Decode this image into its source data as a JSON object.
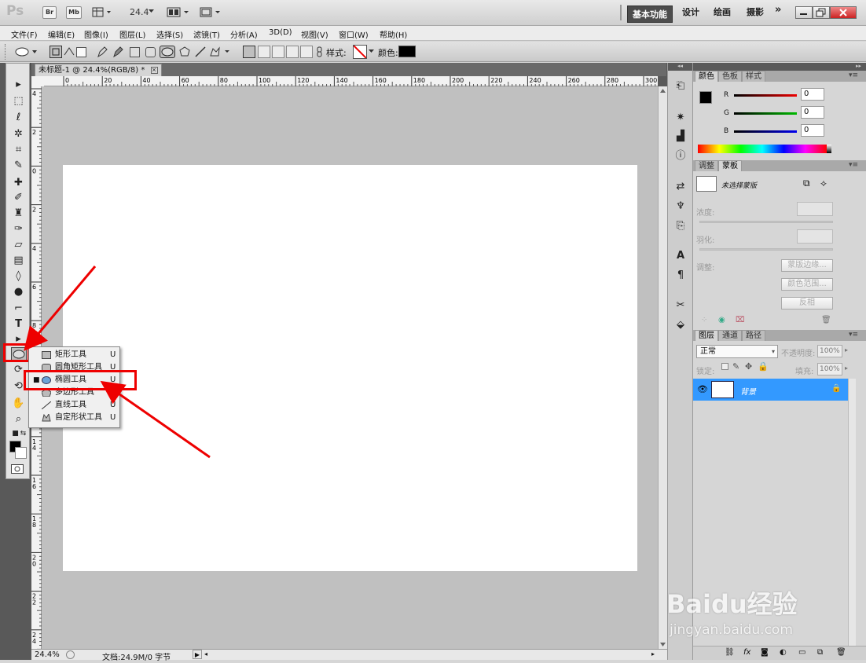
{
  "appbar": {
    "logo": "Ps",
    "bridge": "Br",
    "minibridge": "Mb",
    "zoom": "24.4",
    "workspaces": [
      "基本功能",
      "设计",
      "绘画",
      "摄影"
    ],
    "more": "»"
  },
  "menubar": [
    "文件(F)",
    "编辑(E)",
    "图像(I)",
    "图层(L)",
    "选择(S)",
    "滤镜(T)",
    "分析(A)",
    "3D(D)",
    "视图(V)",
    "窗口(W)",
    "帮助(H)"
  ],
  "options": {
    "style_label": "样式:",
    "color_label": "颜色:",
    "color_value": "#000000"
  },
  "document": {
    "tab_title": "未标题-1 @ 24.4%(RGB/8) *",
    "ruler_h": [
      "0",
      "20",
      "40",
      "60",
      "80",
      "100",
      "120",
      "140",
      "160",
      "180",
      "200",
      "220",
      "240",
      "260",
      "280",
      "300"
    ],
    "ruler_v": [
      "4",
      "2",
      "0",
      "2",
      "4",
      "6",
      "8",
      "1 0",
      "1 2",
      "1 4",
      "1 6",
      "1 8",
      "2 0",
      "2 2",
      "2 4",
      "2 6"
    ],
    "zoom_status": "24.4%",
    "doc_info": "文档:24.9M/0 字节"
  },
  "flyout": {
    "items": [
      {
        "label": "矩形工具",
        "shortcut": "U",
        "selected": false
      },
      {
        "label": "圆角矩形工具",
        "shortcut": "U",
        "selected": false
      },
      {
        "label": "椭圆工具",
        "shortcut": "U",
        "selected": true
      },
      {
        "label": "多边形工具",
        "shortcut": "U",
        "selected": false
      },
      {
        "label": "直线工具",
        "shortcut": "U",
        "selected": false
      },
      {
        "label": "自定形状工具",
        "shortcut": "U",
        "selected": false
      }
    ]
  },
  "color_panel": {
    "tabs": [
      "颜色",
      "色板",
      "样式"
    ],
    "channels": [
      {
        "label": "R",
        "value": "0",
        "color": "#e00000"
      },
      {
        "label": "G",
        "value": "0",
        "color": "#00b000"
      },
      {
        "label": "B",
        "value": "0",
        "color": "#0000e0"
      }
    ]
  },
  "adjust_panel": {
    "tabs": [
      "调整",
      "蒙板"
    ],
    "no_mask": "未选择蒙版",
    "density": "浓度:",
    "feather": "羽化:",
    "refine": "调整:",
    "buttons": [
      "蒙版边缘...",
      "颜色范围...",
      "反相"
    ]
  },
  "layers_panel": {
    "tabs": [
      "图层",
      "通道",
      "路径"
    ],
    "blend_mode": "正常",
    "opacity_label": "不透明度:",
    "opacity": "100%",
    "lock_label": "锁定:",
    "fill_label": "填充:",
    "fill": "100%",
    "layers": [
      {
        "name": "背景",
        "selected": true
      }
    ]
  },
  "watermark": {
    "brand": "Baidu经验",
    "url": "jingyan.baidu.com"
  },
  "colors": {
    "accent": "#3399ff",
    "highlight": "#e00000"
  }
}
